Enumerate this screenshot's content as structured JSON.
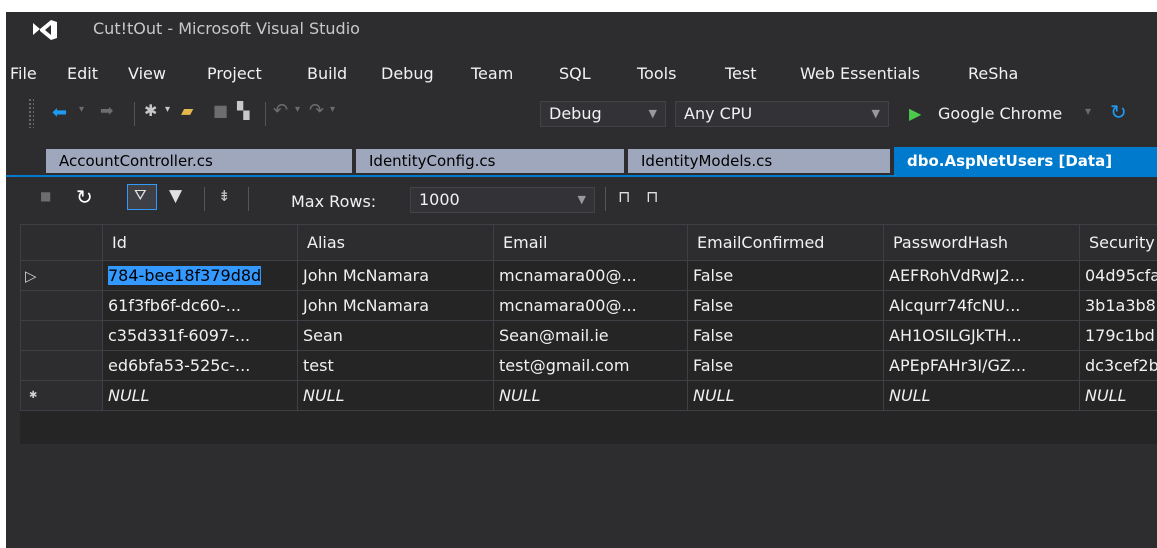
{
  "window": {
    "title": "Cut!tOut - Microsoft Visual Studio"
  },
  "menu": [
    "File",
    "Edit",
    "View",
    "Project",
    "Build",
    "Debug",
    "Team",
    "SQL",
    "Tools",
    "Test",
    "Web Essentials",
    "ReSha"
  ],
  "toolbar": {
    "config": "Debug",
    "platform": "Any CPU",
    "run_target": "Google Chrome",
    "run_dropdown": "▾"
  },
  "tabs": [
    {
      "label": "AccountController.cs",
      "active": false
    },
    {
      "label": "IdentityConfig.cs",
      "active": false
    },
    {
      "label": "IdentityModels.cs",
      "active": false
    },
    {
      "label": "dbo.AspNetUsers [Data]",
      "active": true
    }
  ],
  "data_toolbar": {
    "max_rows_label": "Max Rows:",
    "max_rows_value": "1000"
  },
  "grid": {
    "columns": [
      "Id",
      "Alias",
      "Email",
      "EmailConfirmed",
      "PasswordHash",
      "Security"
    ],
    "rows": [
      {
        "marker": "▷",
        "cells": [
          "784-bee18f379d8d",
          "John McNamara",
          "mcnamara00@...",
          "False",
          "AEFRohVdRwJ2...",
          "04d95cfa"
        ]
      },
      {
        "marker": "",
        "cells": [
          "61f3fb6f-dc60-...",
          "John McNamara",
          "mcnamara00@...",
          "False",
          "AIcqurr74fcNU...",
          "3b1a3b8"
        ]
      },
      {
        "marker": "",
        "cells": [
          "c35d331f-6097-...",
          "Sean",
          "Sean@mail.ie",
          "False",
          "AH1OSILGJkTH...",
          "179c1bd"
        ]
      },
      {
        "marker": "",
        "cells": [
          "ed6bfa53-525c-...",
          "test",
          "test@gmail.com",
          "False",
          "APEpFAHr3I/GZ...",
          "dc3cef2b"
        ]
      },
      {
        "marker": "✱",
        "cells": [
          "NULL",
          "NULL",
          "NULL",
          "NULL",
          "NULL",
          "NULL"
        ]
      }
    ]
  },
  "colors": {
    "accent": "#007acc",
    "background": "#2d2d30",
    "tab_inactive": "#9fa7bd",
    "selection": "#3399ff"
  }
}
